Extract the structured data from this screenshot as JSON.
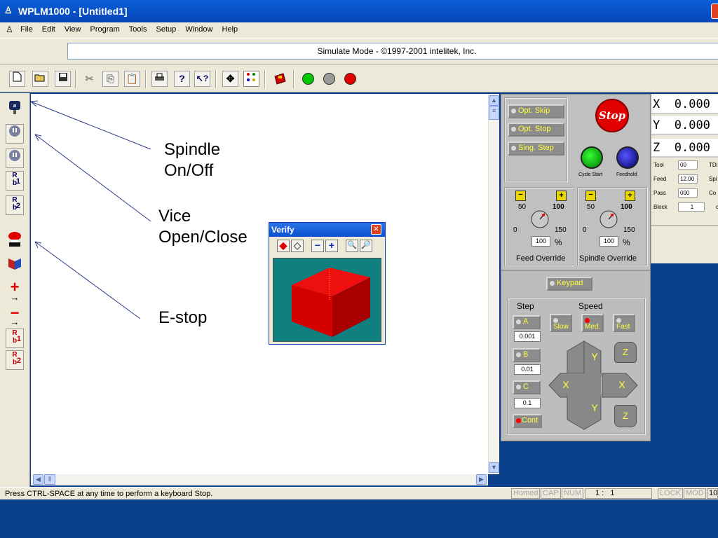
{
  "window": {
    "title": "WPLM1000 - [Untitled1]"
  },
  "menu": [
    "File",
    "Edit",
    "View",
    "Program",
    "Tools",
    "Setup",
    "Window",
    "Help"
  ],
  "mode_text": "Simulate Mode - ©1997-2001 intelitek, Inc.",
  "toolbar_icons": [
    "new-file-icon",
    "open-folder-icon",
    "save-icon",
    "cut-icon",
    "copy-icon",
    "paste-icon",
    "print-icon",
    "help-icon",
    "context-help-icon",
    "axes-icon",
    "grid-icon",
    "toolbox-icon",
    "green-lamp-icon",
    "gray-lamp-icon",
    "red-lamp-icon"
  ],
  "colors": {
    "green_lamp": "#00c800",
    "gray_lamp": "#9a9a9a",
    "red_lamp": "#e00000",
    "verify_bg": "#0f7f80",
    "panel_bg": "#c0c0c0",
    "button_text": "#ffff40",
    "titlebar": "#0a5fd8"
  },
  "left_toolbar": {
    "buttons": [
      "spindle-on",
      "spindle-off",
      "vice-open",
      "vice-close",
      "estop",
      "robot-open",
      "robot-close",
      "robot-1",
      "robot-2"
    ],
    "labels": {
      "r1": "1",
      "r2": "2",
      "r3": "1",
      "r4": "2"
    }
  },
  "annotations": {
    "spindle": "Spindle\nOn/Off",
    "vice": "Vice\nOpen/Close",
    "estop": "E-stop"
  },
  "verify": {
    "title": "Verify"
  },
  "panel": {
    "opt_skip": "Opt. Skip",
    "opt_stop": "Opt. Stop",
    "sing_step": "Sing. Step",
    "stop": "Stop",
    "cycle_start": "Cycle Start",
    "feedhold": "Feedhold",
    "feed_override": {
      "label": "Feed Override",
      "value": "100",
      "unit": "%",
      "scale": {
        "low": "0",
        "mid": "50",
        "high": "100",
        "max": "150"
      }
    },
    "spindle_override": {
      "label": "Spindle Override",
      "value": "100",
      "unit": "%",
      "scale": {
        "low": "0",
        "mid": "50",
        "high": "100",
        "max": "150"
      }
    },
    "keypad": "Keypad",
    "step_label": "Step",
    "speed_label": "Speed",
    "step_buttons": [
      {
        "label": "A",
        "value": "0.001"
      },
      {
        "label": "B",
        "value": "0.01"
      },
      {
        "label": "C",
        "value": "0.1"
      },
      {
        "label": "Cont"
      }
    ],
    "speed_buttons": [
      "Slow",
      "Med.",
      "Fast"
    ],
    "jog": {
      "y_up": "Y",
      "y_down": "Y",
      "x_left": "X",
      "x_right": "X",
      "z_up": "Z",
      "z_down": "Z"
    }
  },
  "dro": {
    "x": {
      "axis": "X",
      "value": "0.000"
    },
    "y": {
      "axis": "Y",
      "value": "0.000"
    },
    "z": {
      "axis": "Z",
      "value": "0.000"
    },
    "tool": {
      "label": "Tool",
      "value": "00",
      "extra": "TDi"
    },
    "feed": {
      "label": "Feed",
      "value": "12.00",
      "extra": "Spi"
    },
    "pass": {
      "label": "Pass",
      "value": "000",
      "extra": "Co"
    },
    "block": {
      "label": "Block",
      "value": "1",
      "extra": "c"
    }
  },
  "status": {
    "message": "Press CTRL-SPACE at any time to perform a keyboard Stop.",
    "homed": "Homed",
    "cap": "CAP",
    "num": "NUM",
    "position": "1 :   1",
    "lock": "LOCK",
    "mod": "MOD",
    "last": "10"
  }
}
